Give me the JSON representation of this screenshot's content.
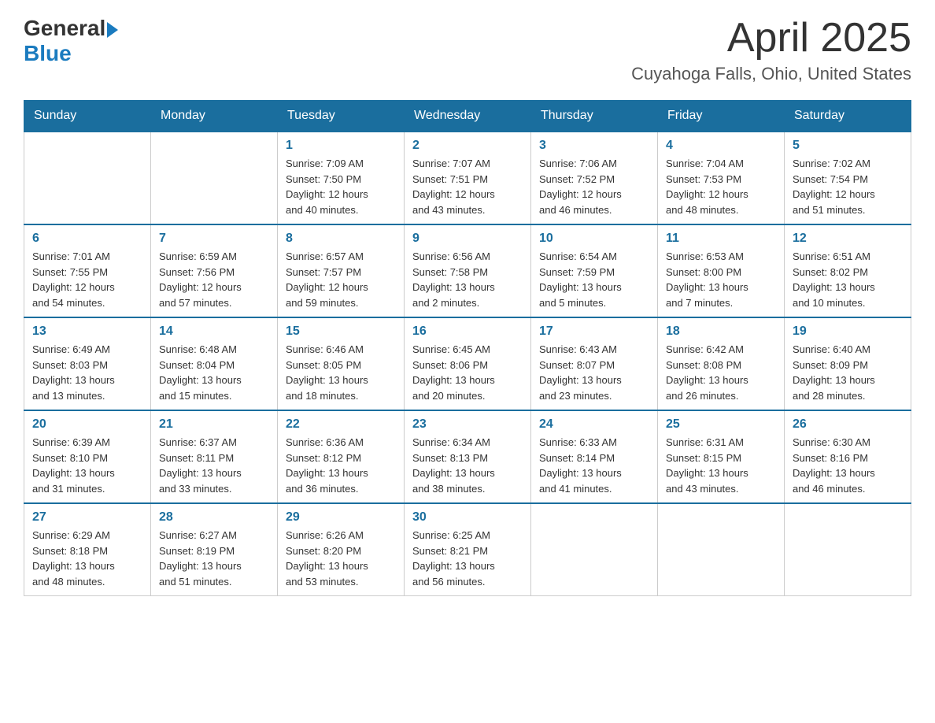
{
  "header": {
    "logo_general": "General",
    "logo_blue": "Blue",
    "title": "April 2025",
    "subtitle": "Cuyahoga Falls, Ohio, United States"
  },
  "calendar": {
    "days_of_week": [
      "Sunday",
      "Monday",
      "Tuesday",
      "Wednesday",
      "Thursday",
      "Friday",
      "Saturday"
    ],
    "weeks": [
      [
        {
          "day": "",
          "info": ""
        },
        {
          "day": "",
          "info": ""
        },
        {
          "day": "1",
          "info": "Sunrise: 7:09 AM\nSunset: 7:50 PM\nDaylight: 12 hours\nand 40 minutes."
        },
        {
          "day": "2",
          "info": "Sunrise: 7:07 AM\nSunset: 7:51 PM\nDaylight: 12 hours\nand 43 minutes."
        },
        {
          "day": "3",
          "info": "Sunrise: 7:06 AM\nSunset: 7:52 PM\nDaylight: 12 hours\nand 46 minutes."
        },
        {
          "day": "4",
          "info": "Sunrise: 7:04 AM\nSunset: 7:53 PM\nDaylight: 12 hours\nand 48 minutes."
        },
        {
          "day": "5",
          "info": "Sunrise: 7:02 AM\nSunset: 7:54 PM\nDaylight: 12 hours\nand 51 minutes."
        }
      ],
      [
        {
          "day": "6",
          "info": "Sunrise: 7:01 AM\nSunset: 7:55 PM\nDaylight: 12 hours\nand 54 minutes."
        },
        {
          "day": "7",
          "info": "Sunrise: 6:59 AM\nSunset: 7:56 PM\nDaylight: 12 hours\nand 57 minutes."
        },
        {
          "day": "8",
          "info": "Sunrise: 6:57 AM\nSunset: 7:57 PM\nDaylight: 12 hours\nand 59 minutes."
        },
        {
          "day": "9",
          "info": "Sunrise: 6:56 AM\nSunset: 7:58 PM\nDaylight: 13 hours\nand 2 minutes."
        },
        {
          "day": "10",
          "info": "Sunrise: 6:54 AM\nSunset: 7:59 PM\nDaylight: 13 hours\nand 5 minutes."
        },
        {
          "day": "11",
          "info": "Sunrise: 6:53 AM\nSunset: 8:00 PM\nDaylight: 13 hours\nand 7 minutes."
        },
        {
          "day": "12",
          "info": "Sunrise: 6:51 AM\nSunset: 8:02 PM\nDaylight: 13 hours\nand 10 minutes."
        }
      ],
      [
        {
          "day": "13",
          "info": "Sunrise: 6:49 AM\nSunset: 8:03 PM\nDaylight: 13 hours\nand 13 minutes."
        },
        {
          "day": "14",
          "info": "Sunrise: 6:48 AM\nSunset: 8:04 PM\nDaylight: 13 hours\nand 15 minutes."
        },
        {
          "day": "15",
          "info": "Sunrise: 6:46 AM\nSunset: 8:05 PM\nDaylight: 13 hours\nand 18 minutes."
        },
        {
          "day": "16",
          "info": "Sunrise: 6:45 AM\nSunset: 8:06 PM\nDaylight: 13 hours\nand 20 minutes."
        },
        {
          "day": "17",
          "info": "Sunrise: 6:43 AM\nSunset: 8:07 PM\nDaylight: 13 hours\nand 23 minutes."
        },
        {
          "day": "18",
          "info": "Sunrise: 6:42 AM\nSunset: 8:08 PM\nDaylight: 13 hours\nand 26 minutes."
        },
        {
          "day": "19",
          "info": "Sunrise: 6:40 AM\nSunset: 8:09 PM\nDaylight: 13 hours\nand 28 minutes."
        }
      ],
      [
        {
          "day": "20",
          "info": "Sunrise: 6:39 AM\nSunset: 8:10 PM\nDaylight: 13 hours\nand 31 minutes."
        },
        {
          "day": "21",
          "info": "Sunrise: 6:37 AM\nSunset: 8:11 PM\nDaylight: 13 hours\nand 33 minutes."
        },
        {
          "day": "22",
          "info": "Sunrise: 6:36 AM\nSunset: 8:12 PM\nDaylight: 13 hours\nand 36 minutes."
        },
        {
          "day": "23",
          "info": "Sunrise: 6:34 AM\nSunset: 8:13 PM\nDaylight: 13 hours\nand 38 minutes."
        },
        {
          "day": "24",
          "info": "Sunrise: 6:33 AM\nSunset: 8:14 PM\nDaylight: 13 hours\nand 41 minutes."
        },
        {
          "day": "25",
          "info": "Sunrise: 6:31 AM\nSunset: 8:15 PM\nDaylight: 13 hours\nand 43 minutes."
        },
        {
          "day": "26",
          "info": "Sunrise: 6:30 AM\nSunset: 8:16 PM\nDaylight: 13 hours\nand 46 minutes."
        }
      ],
      [
        {
          "day": "27",
          "info": "Sunrise: 6:29 AM\nSunset: 8:18 PM\nDaylight: 13 hours\nand 48 minutes."
        },
        {
          "day": "28",
          "info": "Sunrise: 6:27 AM\nSunset: 8:19 PM\nDaylight: 13 hours\nand 51 minutes."
        },
        {
          "day": "29",
          "info": "Sunrise: 6:26 AM\nSunset: 8:20 PM\nDaylight: 13 hours\nand 53 minutes."
        },
        {
          "day": "30",
          "info": "Sunrise: 6:25 AM\nSunset: 8:21 PM\nDaylight: 13 hours\nand 56 minutes."
        },
        {
          "day": "",
          "info": ""
        },
        {
          "day": "",
          "info": ""
        },
        {
          "day": "",
          "info": ""
        }
      ]
    ]
  }
}
